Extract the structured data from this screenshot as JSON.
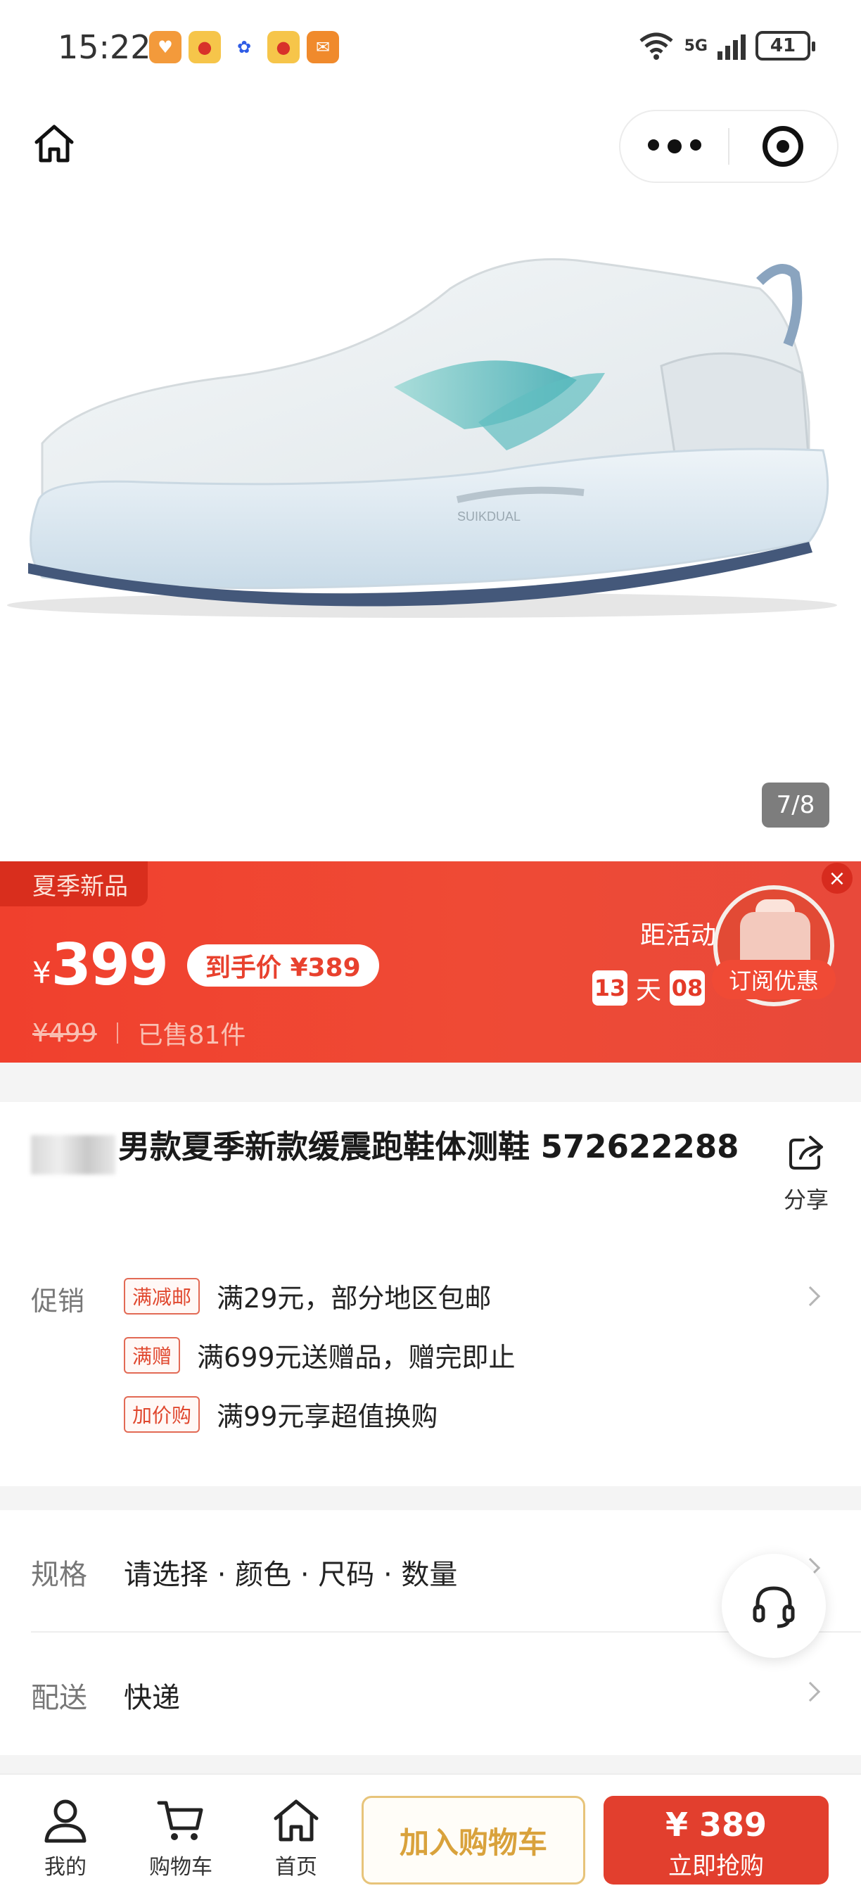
{
  "status_bar": {
    "time": "15:22",
    "network": "5G",
    "battery": "41",
    "app_icons": [
      "heart-app-icon",
      "weibo-icon",
      "baidu-icon",
      "weibo-icon",
      "mail-app-icon"
    ]
  },
  "gallery": {
    "counter": "7/8"
  },
  "promo": {
    "tag": "夏季新品",
    "currency": "¥",
    "price": "399",
    "final_price": "到手价 ¥389",
    "original_price": "¥499",
    "sold": "已售81件",
    "countdown_label": "距活动",
    "countdown_days": "13",
    "countdown_day_unit": "天",
    "countdown_hours": "08",
    "subscribe": "订阅优惠",
    "colors": {
      "banner": "#ef4532",
      "accent": "#e8412e"
    }
  },
  "product": {
    "title": "男款夏季新款缓震跑鞋体测鞋 572622288",
    "share_label": "分享"
  },
  "promotions": {
    "label": "促销",
    "items": [
      {
        "badge": "满减邮",
        "text": "满29元，部分地区包邮"
      },
      {
        "badge": "满赠",
        "text": "满699元送赠品，赠完即止"
      },
      {
        "badge": "加价购",
        "text": "满99元享超值换购"
      }
    ]
  },
  "spec": {
    "label": "规格",
    "value": "请选择 · 颜色 · 尺码 · 数量"
  },
  "delivery": {
    "label": "配送",
    "value": "快递"
  },
  "bottom_bar": {
    "tabs": [
      {
        "label": "我的",
        "icon": "user-icon"
      },
      {
        "label": "购物车",
        "icon": "cart-icon"
      },
      {
        "label": "首页",
        "icon": "home-icon"
      }
    ],
    "add_to_cart": "加入购物车",
    "buy_price": "¥ 389",
    "buy_label": "立即抢购"
  }
}
